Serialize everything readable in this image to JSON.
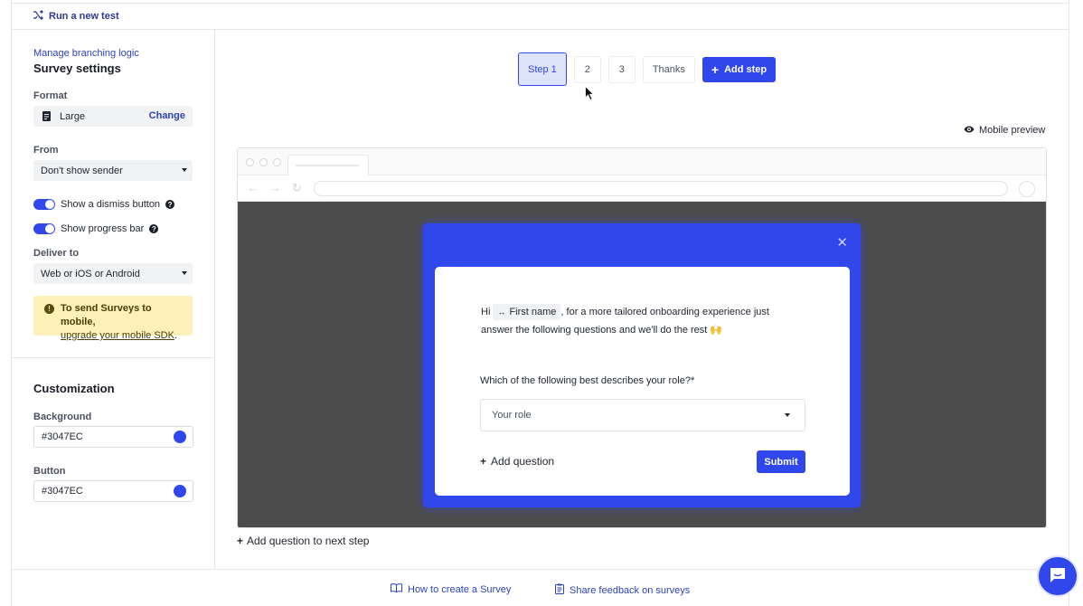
{
  "topbar": {
    "run_test_label": "Run a new test"
  },
  "sidebar": {
    "manage_link": "Manage branching logic",
    "title": "Survey settings",
    "format": {
      "label": "Format",
      "value": "Large",
      "change_label": "Change"
    },
    "from": {
      "label": "From",
      "value": "Don't show sender"
    },
    "toggles": [
      {
        "label": "Show a dismiss button",
        "on": true
      },
      {
        "label": "Show progress bar",
        "on": true
      }
    ],
    "deliver": {
      "label": "Deliver to",
      "value": "Web or iOS or Android"
    },
    "notice": {
      "bold": "To send Surveys to mobile,",
      "link": "upgrade your mobile SDK",
      "suffix": "."
    },
    "customization": {
      "title": "Customization",
      "background": {
        "label": "Background",
        "value": "#3047EC"
      },
      "button": {
        "label": "Button",
        "value": "#3047EC"
      }
    }
  },
  "steps": {
    "items": [
      "Step 1",
      "2",
      "3",
      "Thanks"
    ],
    "active_index": 0,
    "add_label": "Add step"
  },
  "mobile_preview_label": "Mobile preview",
  "survey": {
    "intro_before": "Hi",
    "chip_label": "First name",
    "intro_after": ", for a more tailored onboarding experience just answer the following questions and we'll do the rest 🙌",
    "question": "Which of the following best describes your role?*",
    "select_placeholder": "Your role",
    "add_question_label": "Add question",
    "submit_label": "Submit"
  },
  "add_next_step_label": "Add question to next step",
  "footer": {
    "how_to": "How to create a Survey",
    "feedback": "Share feedback on surveys"
  },
  "colors": {
    "accent": "#3047EC",
    "viewport_bg": "#4C4C4C",
    "notice_bg": "#FDF0B8"
  },
  "icons": [
    "shuffle-icon",
    "document-icon",
    "help-icon",
    "warning-icon",
    "eye-icon",
    "code-icon",
    "close-icon",
    "book-icon",
    "clipboard-icon",
    "chat-icon"
  ]
}
